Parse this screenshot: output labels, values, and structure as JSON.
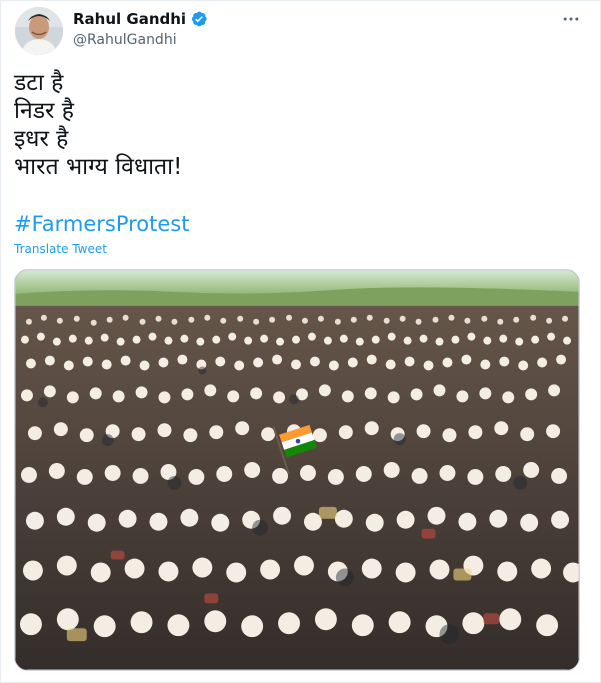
{
  "author": {
    "display_name": "Rahul Gandhi",
    "handle": "@RahulGandhi",
    "verified": true
  },
  "tweet": {
    "lines": [
      "डटा है",
      "निडर है",
      "इधर है",
      "भारत भाग्य विधाता!"
    ],
    "hashtag": "#FarmersProtest",
    "translate_label": "Translate Tweet"
  },
  "media": {
    "kind": "photo"
  },
  "icons": {
    "more": "more-horizontal-icon",
    "verified": "verified-badge-icon"
  },
  "colors": {
    "link": "#1d9bf0",
    "text": "#0f1419",
    "muted": "#536471",
    "verified": "#1d9bf0"
  }
}
